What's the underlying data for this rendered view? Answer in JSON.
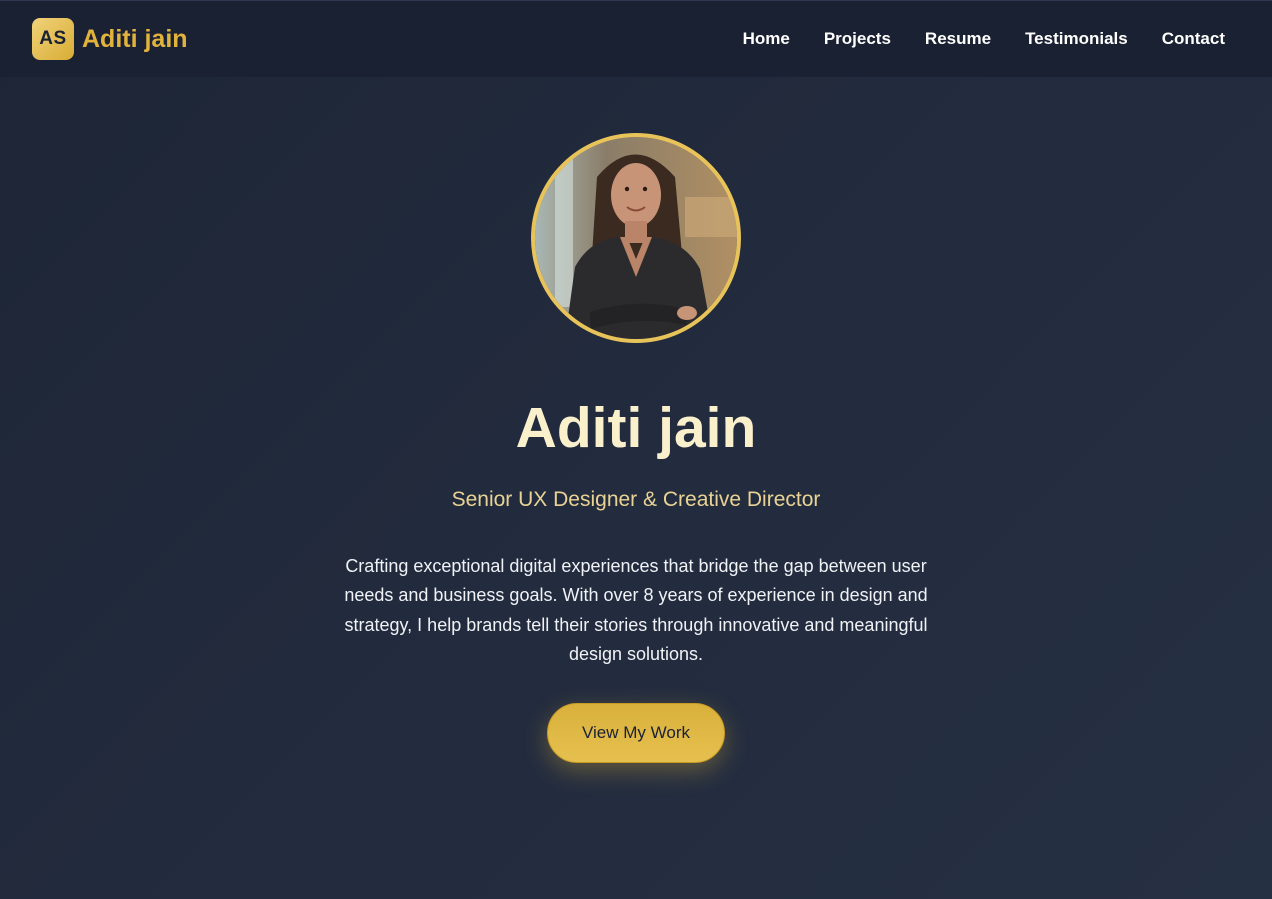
{
  "colors": {
    "accent": "#e2b33c",
    "background": "#222b3d",
    "navbar": "#1a2133",
    "heading": "#fbf0cc",
    "subtitle": "#e9d394"
  },
  "brand": {
    "initials": "AS",
    "name": "Aditi jain"
  },
  "nav": {
    "items": [
      {
        "label": "Home"
      },
      {
        "label": "Projects"
      },
      {
        "label": "Resume"
      },
      {
        "label": "Testimonials"
      },
      {
        "label": "Contact"
      }
    ]
  },
  "hero": {
    "avatar_icon": "profile-photo",
    "name": "Aditi jain",
    "role": "Senior UX Designer & Creative Director",
    "bio": "Crafting exceptional digital experiences that bridge the gap between user needs and business goals. With over 8 years of experience in design and strategy, I help brands tell their stories through innovative and meaningful design solutions.",
    "cta_label": "View My Work"
  }
}
